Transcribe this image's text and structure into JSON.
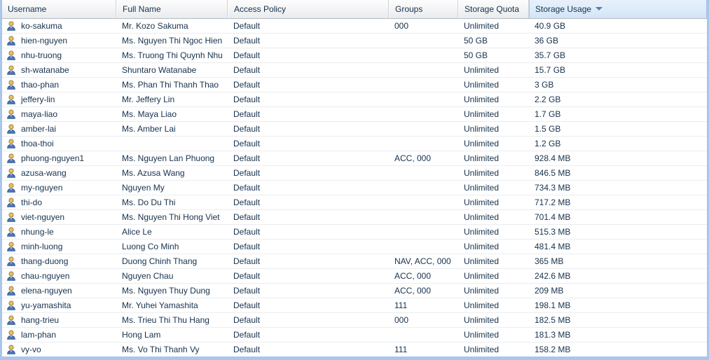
{
  "grid": {
    "columns": [
      {
        "key": "username",
        "label": "Username",
        "sorted": false
      },
      {
        "key": "fullname",
        "label": "Full Name",
        "sorted": false
      },
      {
        "key": "policy",
        "label": "Access Policy",
        "sorted": false
      },
      {
        "key": "groups",
        "label": "Groups",
        "sorted": false
      },
      {
        "key": "quota",
        "label": "Storage Quota",
        "sorted": false
      },
      {
        "key": "usage",
        "label": "Storage Usage",
        "sorted": true,
        "sort_direction": "desc",
        "sort_icon": "chevron-down-icon"
      }
    ],
    "row_icon": "user-icon",
    "colors": {
      "panel_border": "#aac6e8",
      "header_sorted_bg": "#dcebf9",
      "header_text": "#16314d",
      "row_separator": "#ebedf0",
      "sort_arrow": "#5b7fa6"
    },
    "rows": [
      {
        "username": "ko-sakuma",
        "fullname": "Mr. Kozo Sakuma",
        "policy": "Default",
        "groups": "000",
        "quota": "Unlimited",
        "usage": "40.9 GB"
      },
      {
        "username": "hien-nguyen",
        "fullname": "Ms. Nguyen Thi Ngoc Hien",
        "policy": "Default",
        "groups": "",
        "quota": "50 GB",
        "usage": "36 GB"
      },
      {
        "username": "nhu-truong",
        "fullname": "Ms. Truong Thi Quynh Nhu",
        "policy": "Default",
        "groups": "",
        "quota": "50 GB",
        "usage": "35.7 GB"
      },
      {
        "username": "sh-watanabe",
        "fullname": "Shuntaro Watanabe",
        "policy": "Default",
        "groups": "",
        "quota": "Unlimited",
        "usage": "15.7 GB"
      },
      {
        "username": "thao-phan",
        "fullname": "Ms. Phan Thi Thanh Thao",
        "policy": "Default",
        "groups": "",
        "quota": "Unlimited",
        "usage": "3 GB"
      },
      {
        "username": "jeffery-lin",
        "fullname": "Mr. Jeffery Lin",
        "policy": "Default",
        "groups": "",
        "quota": "Unlimited",
        "usage": "2.2 GB"
      },
      {
        "username": "maya-liao",
        "fullname": "Ms. Maya Liao",
        "policy": "Default",
        "groups": "",
        "quota": "Unlimited",
        "usage": "1.7 GB"
      },
      {
        "username": "amber-lai",
        "fullname": "Ms. Amber Lai",
        "policy": "Default",
        "groups": "",
        "quota": "Unlimited",
        "usage": "1.5 GB"
      },
      {
        "username": "thoa-thoi",
        "fullname": "",
        "policy": "Default",
        "groups": "",
        "quota": "Unlimited",
        "usage": "1.2 GB"
      },
      {
        "username": "phuong-nguyen1",
        "fullname": "Ms. Nguyen Lan Phuong",
        "policy": "Default",
        "groups": "ACC, 000",
        "quota": "Unlimited",
        "usage": "928.4 MB"
      },
      {
        "username": "azusa-wang",
        "fullname": "Ms. Azusa Wang",
        "policy": "Default",
        "groups": "",
        "quota": "Unlimited",
        "usage": "846.5 MB"
      },
      {
        "username": "my-nguyen",
        "fullname": "Nguyen My",
        "policy": "Default",
        "groups": "",
        "quota": "Unlimited",
        "usage": "734.3 MB"
      },
      {
        "username": "thi-do",
        "fullname": "Ms. Do Du Thi",
        "policy": "Default",
        "groups": "",
        "quota": "Unlimited",
        "usage": "717.2 MB"
      },
      {
        "username": "viet-nguyen",
        "fullname": "Ms. Nguyen Thi Hong Viet",
        "policy": "Default",
        "groups": "",
        "quota": "Unlimited",
        "usage": "701.4 MB"
      },
      {
        "username": "nhung-le",
        "fullname": "Alice Le",
        "policy": "Default",
        "groups": "",
        "quota": "Unlimited",
        "usage": "515.3 MB"
      },
      {
        "username": "minh-luong",
        "fullname": "Luong Co Minh",
        "policy": "Default",
        "groups": "",
        "quota": "Unlimited",
        "usage": "481.4 MB"
      },
      {
        "username": "thang-duong",
        "fullname": "Duong Chinh Thang",
        "policy": "Default",
        "groups": "NAV, ACC, 000",
        "quota": "Unlimited",
        "usage": "365 MB"
      },
      {
        "username": "chau-nguyen",
        "fullname": "Nguyen Chau",
        "policy": "Default",
        "groups": "ACC, 000",
        "quota": "Unlimited",
        "usage": "242.6 MB"
      },
      {
        "username": "elena-nguyen",
        "fullname": "Ms. Nguyen Thuy Dung",
        "policy": "Default",
        "groups": "ACC, 000",
        "quota": "Unlimited",
        "usage": "209 MB"
      },
      {
        "username": "yu-yamashita",
        "fullname": "Mr. Yuhei Yamashita",
        "policy": "Default",
        "groups": "111",
        "quota": "Unlimited",
        "usage": "198.1 MB"
      },
      {
        "username": "hang-trieu",
        "fullname": "Ms. Trieu Thi Thu Hang",
        "policy": "Default",
        "groups": "000",
        "quota": "Unlimited",
        "usage": "182.5 MB"
      },
      {
        "username": "lam-phan",
        "fullname": "Hong Lam",
        "policy": "Default",
        "groups": "",
        "quota": "Unlimited",
        "usage": "181.3 MB"
      },
      {
        "username": "vy-vo",
        "fullname": "Ms. Vo Thi Thanh Vy",
        "policy": "Default",
        "groups": "111",
        "quota": "Unlimited",
        "usage": "158.2 MB"
      }
    ]
  }
}
